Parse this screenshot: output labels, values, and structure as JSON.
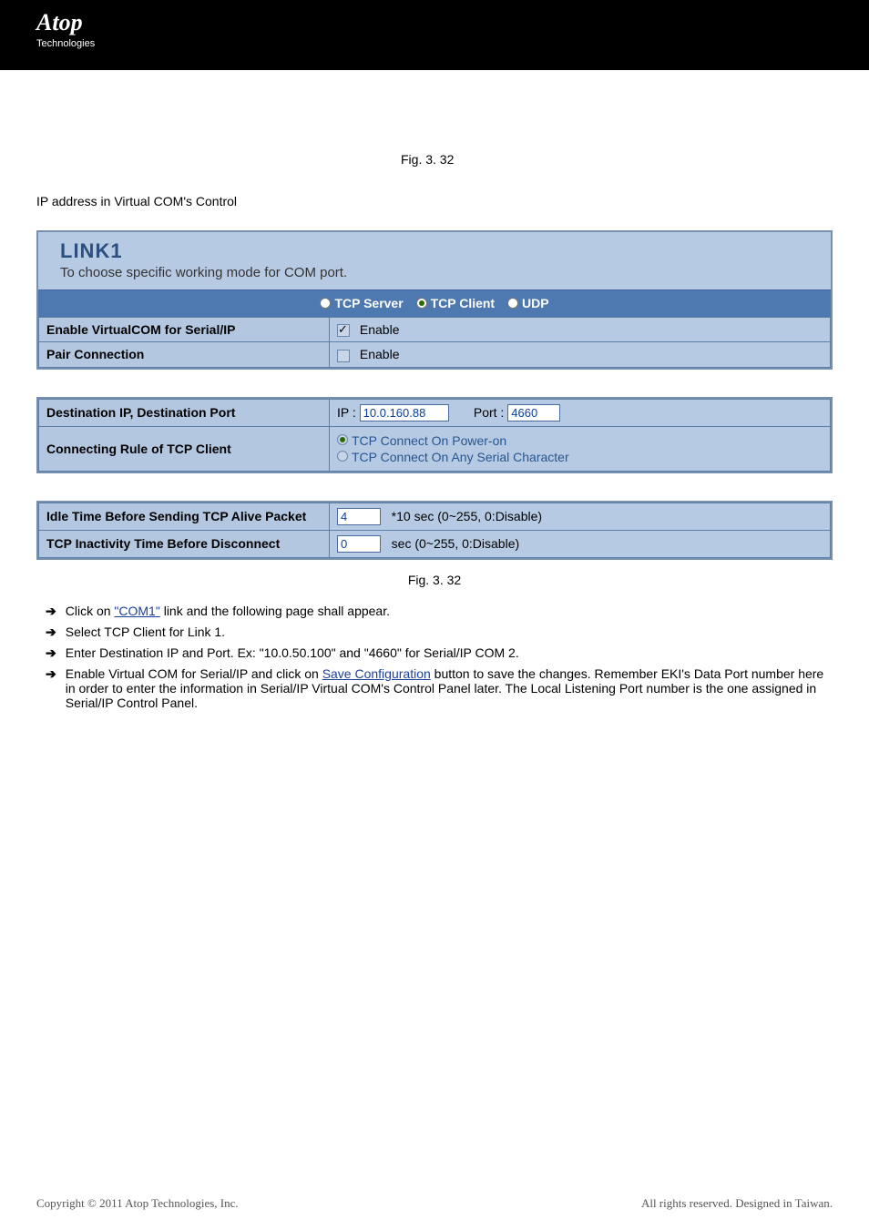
{
  "header": {
    "brand": "Atop",
    "brandsub": "Technologies"
  },
  "figref_top": "Fig. 3. 32",
  "line_above": "IP address in Virtual COM's Control",
  "panel": {
    "title": "LINK1",
    "subtitle": "To choose specific working mode for COM port.",
    "mode": {
      "server": "TCP Server",
      "client": "TCP Client",
      "udp": "UDP"
    },
    "rows": {
      "vcom_label": "Enable VirtualCOM for Serial/IP",
      "vcom_enable": "Enable",
      "pair_label": "Pair Connection",
      "pair_enable": "Enable",
      "dest_label": "Destination IP, Destination Port",
      "dest_ip_prefix": "IP :",
      "dest_ip": "10.0.160.88",
      "dest_port_prefix": "Port :",
      "dest_port": "4660",
      "rule_label": "Connecting Rule of TCP Client",
      "rule_opt1": "TCP Connect On Power-on",
      "rule_opt2": "TCP Connect On Any Serial Character",
      "idle_label": "Idle Time Before Sending TCP Alive Packet",
      "idle_val": "4",
      "idle_suffix": "*10 sec (0~255, 0:Disable)",
      "inact_label": "TCP Inactivity Time Before Disconnect",
      "inact_val": "0",
      "inact_suffix": "sec (0~255, 0:Disable)"
    }
  },
  "figref_mid": "Fig. 3. 32",
  "bullets": {
    "b1_pre": "Click on ",
    "b1_link": "\"COM1\"",
    "b1_post": " link and the following page shall appear.",
    "b2": "Select TCP Client for Link 1.",
    "b3": "Enter Destination IP and Port. Ex:  \"10.0.50.100\"  and  \"4660\"  for Serial/IP COM 2.",
    "b4_pre": "Enable Virtual COM for Serial/IP and click on ",
    "b4_link": "Save Configuration",
    "b4_post": " button to save the changes. Remember EKI's Data Port number here in order to enter the information in Serial/IP Virtual COM's Control Panel later. The Local Listening Port number is the one assigned in Serial/IP Control Panel."
  },
  "footer": {
    "copy": "Copyright © 2011 Atop Technologies, Inc.",
    "right": "All rights reserved. Designed in Taiwan."
  }
}
